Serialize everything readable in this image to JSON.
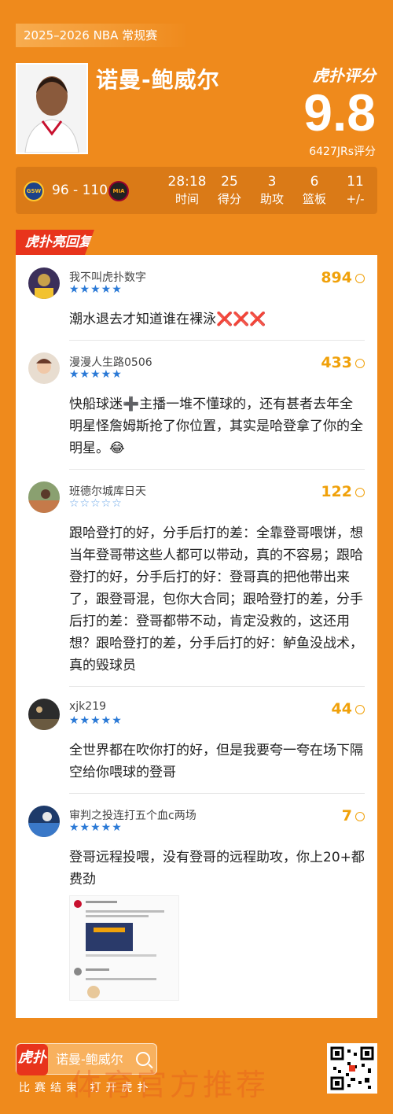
{
  "header": {
    "season": "2025–2026 NBA 常规赛",
    "player_name": "诺曼-鲍威尔",
    "brand": "虎扑评分",
    "score": "9.8",
    "ratings_count": "6427JRs评分"
  },
  "game": {
    "home_abbr": "GSW",
    "away_abbr": "MIA",
    "score": "96 - 110",
    "stats": [
      {
        "value": "28:18",
        "label": "时间"
      },
      {
        "value": "25",
        "label": "得分"
      },
      {
        "value": "3",
        "label": "助攻"
      },
      {
        "value": "6",
        "label": "篮板"
      },
      {
        "value": "11",
        "label": "+/-"
      }
    ]
  },
  "section_tag": "虎扑亮回复",
  "comments": [
    {
      "user": "我不叫虎扑数字",
      "likes": "894",
      "stars": 5,
      "text": "潮水退去才知道谁在裸泳❌❌❌"
    },
    {
      "user": "漫漫人生路0506",
      "likes": "433",
      "stars": 5,
      "text": "快船球迷➕主播一堆不懂球的，还有甚者去年全明星怪詹姆斯抢了你位置，其实是哈登拿了你的全明星。😂"
    },
    {
      "user": "班德尔城库日天",
      "likes": "122",
      "stars": 0,
      "text": "跟哈登打的好，分手后打的差：全靠登哥喂饼，想当年登哥带这些人都可以带动，真的不容易；跟哈登打的好，分手后打的好：登哥真的把他带出来了，跟登哥混，包你大合同；跟哈登打的差，分手后打的差：登哥都带不动，肯定没救的，这还用想？跟哈登打的差，分手后打的好：鲈鱼没战术，真的毁球员"
    },
    {
      "user": "xjk219",
      "likes": "44",
      "stars": 5,
      "text": "全世界都在吹你打的好，但是我要夸一夸在场下隔空给你喂球的登哥"
    },
    {
      "user": "审判之投连打五个血c两场",
      "likes": "7",
      "stars": 5,
      "text": "登哥远程投喂，没有登哥的远程助攻，你上20+都费劲"
    }
  ],
  "footer": {
    "logo": "虎扑",
    "search_text": "诺曼-鲍威尔",
    "subtitle": "比赛结束 打开虎扑",
    "watermark": "体育官方推荐"
  },
  "colors": {
    "background": "#ef8a1c",
    "star": "#2a79d6",
    "likes": "#f0a10a",
    "tag": "#e8341c"
  }
}
